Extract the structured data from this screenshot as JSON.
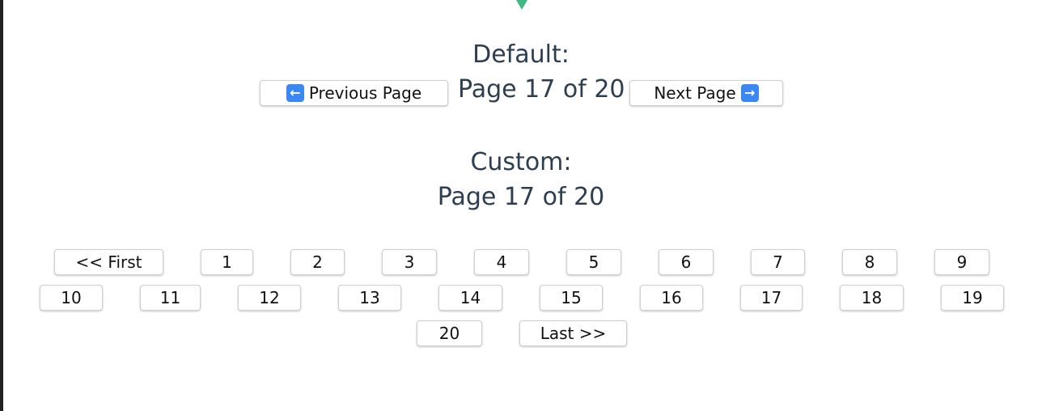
{
  "default_section": {
    "heading": "Default:",
    "prev_label": "Previous Page",
    "page_text": "Page 17 of 20",
    "next_label": "Next Page"
  },
  "custom_section": {
    "heading": "Custom:",
    "page_text": "Page 17 of 20",
    "first_label": "<< First",
    "last_label": "Last >>",
    "pages": [
      "1",
      "2",
      "3",
      "4",
      "5",
      "6",
      "7",
      "8",
      "9",
      "10",
      "11",
      "12",
      "13",
      "14",
      "15",
      "16",
      "17",
      "18",
      "19",
      "20"
    ]
  },
  "icons": {
    "prev": "arrow-left-icon",
    "next": "arrow-right-icon",
    "marker": "triangle-down-icon"
  },
  "colors": {
    "text": "#2c3e50",
    "accent": "#42b983",
    "emoji_blue": "#3b88f5"
  }
}
